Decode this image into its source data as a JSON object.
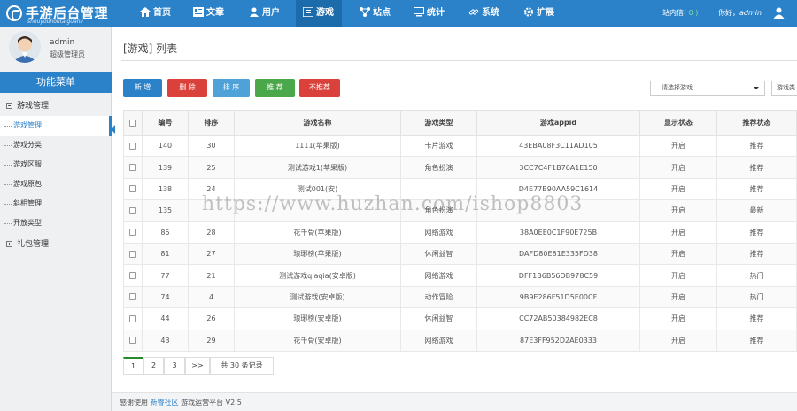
{
  "brand": {
    "title": "手游后台管理",
    "subtitle": "shouyouhoutaiguanli"
  },
  "nav": [
    {
      "label": "首页",
      "icon": "home-icon"
    },
    {
      "label": "文章",
      "icon": "article-icon"
    },
    {
      "label": "用户",
      "icon": "user-icon"
    },
    {
      "label": "游戏",
      "icon": "game-icon"
    },
    {
      "label": "站点",
      "icon": "site-icon"
    },
    {
      "label": "统计",
      "icon": "monitor-icon"
    },
    {
      "label": "系统",
      "icon": "link-icon"
    },
    {
      "label": "扩展",
      "icon": "gear-icon"
    }
  ],
  "topbar": {
    "msg_label": "站内信",
    "msg_count": "( 0 )",
    "hello": "你好，",
    "username": "admin"
  },
  "profile": {
    "name": "admin",
    "role": "超级管理员"
  },
  "sidebar": {
    "menu_title": "功能菜单",
    "groups": [
      {
        "label": "游戏管理"
      },
      {
        "label": "礼包管理"
      }
    ],
    "items": [
      "游戏管理",
      "游戏分类",
      "游戏区服",
      "游戏原包",
      "斜相管理",
      "开放类型"
    ]
  },
  "page": {
    "title": "[游戏] 列表"
  },
  "toolbar": {
    "new": "新 增",
    "delete": "删 除",
    "sort": "排 序",
    "recommend": "推 荐",
    "unrecommend": "不推荐"
  },
  "filters": {
    "game_select": "请选择游戏",
    "second_select": "游戏类"
  },
  "table": {
    "headers": [
      "编号",
      "排序",
      "游戏名称",
      "游戏类型",
      "游戏appid",
      "显示状态",
      "推荐状态"
    ],
    "rows": [
      [
        "140",
        "30",
        "1111(苹果版)",
        "卡片游戏",
        "43EBA08F3C11AD105",
        "开启",
        "推荐"
      ],
      [
        "139",
        "25",
        "测试游戏1(苹果版)",
        "角色扮演",
        "3CC7C4F1B76A1E150",
        "开启",
        "推荐"
      ],
      [
        "138",
        "24",
        "测试001(安)",
        "",
        "D4E77B90AA59C1614",
        "开启",
        "推荐"
      ],
      [
        "135",
        "",
        "",
        "角色扮演",
        "",
        "开启",
        "最新"
      ],
      [
        "85",
        "28",
        "花千骨(苹果版)",
        "网络游戏",
        "38A0EE0C1F90E725B",
        "开启",
        "推荐"
      ],
      [
        "81",
        "27",
        "琅琊榜(苹果版)",
        "休闲益智",
        "DAFD80E81E335FD38",
        "开启",
        "推荐"
      ],
      [
        "77",
        "21",
        "测试游戏qiaqia(安卓版)",
        "网络游戏",
        "DFF1B6B56DB978C59",
        "开启",
        "热门"
      ],
      [
        "74",
        "4",
        "测试游戏(安卓版)",
        "动作冒险",
        "9B9E286F51D5E00CF",
        "开启",
        "热门"
      ],
      [
        "44",
        "26",
        "琅琊榜(安卓版)",
        "休闲益智",
        "CC72AB50384982EC8",
        "开启",
        "推荐"
      ],
      [
        "43",
        "29",
        "花千骨(安卓版)",
        "网络游戏",
        "87E3FF952D2AE0333",
        "开启",
        "推荐"
      ]
    ]
  },
  "pager": {
    "pages": [
      "1",
      "2",
      "3",
      ">>"
    ],
    "total": "共 30 条记录"
  },
  "footer": {
    "prefix": "感谢使用",
    "link": "新睿社区",
    "suffix": "游戏运营平台 V2.5"
  },
  "watermark": "https://www.huzhan.com/ishop8803",
  "colors": {
    "primary": "#2c82c9",
    "danger": "#d9413a",
    "info": "#4fa2d8",
    "success": "#4aa84a"
  }
}
